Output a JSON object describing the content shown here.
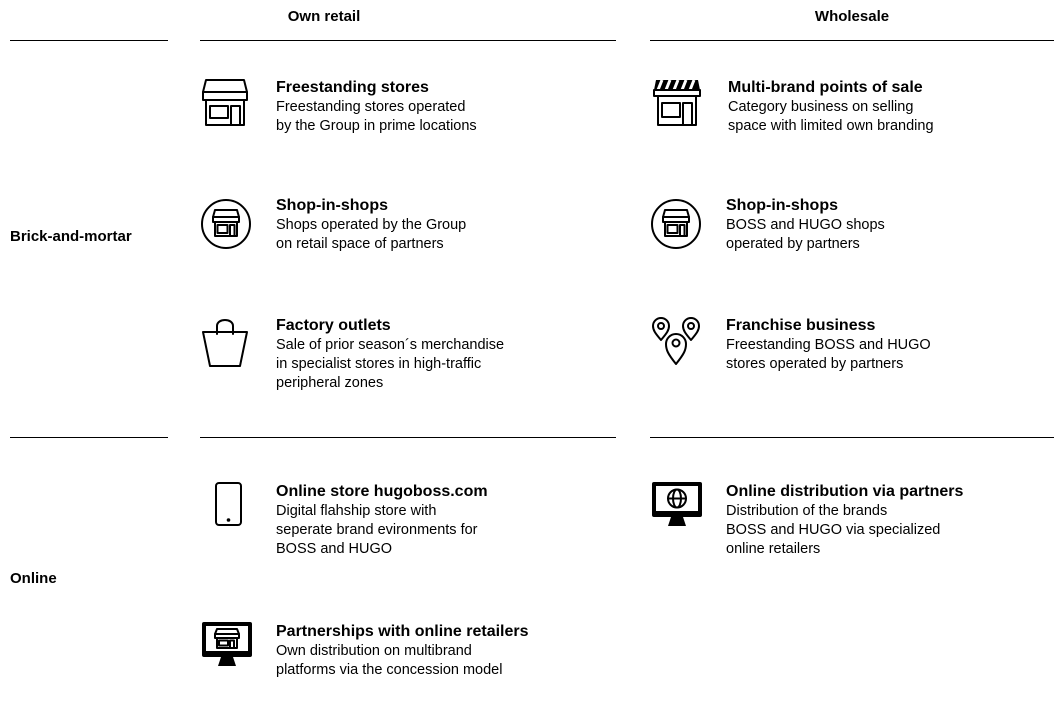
{
  "columns": {
    "own_retail": "Own retail",
    "wholesale": "Wholesale"
  },
  "rows": {
    "brick": "Brick-and-mortar",
    "online": "Online"
  },
  "items": {
    "freestanding": {
      "icon": "storefront-icon",
      "title": "Freestanding stores",
      "desc": "Freestanding stores operated\nby the Group in prime locations"
    },
    "multibrand": {
      "icon": "striped-awning-storefront-icon",
      "title": "Multi-brand points of sale",
      "desc": "Category business on selling\nspace with limited own branding"
    },
    "sis_own": {
      "icon": "circled-storefront-icon",
      "title": "Shop-in-shops",
      "desc": "Shops operated by the Group\non retail space of partners"
    },
    "sis_wholesale": {
      "icon": "circled-storefront-icon",
      "title": "Shop-in-shops",
      "desc": "BOSS and HUGO shops\noperated by partners"
    },
    "factory": {
      "icon": "shopping-bag-icon",
      "title": "Factory outlets",
      "desc": "Sale of prior season´s merchandise\nin specialist stores in high-traffic\nperipheral zones"
    },
    "franchise": {
      "icon": "location-pins-icon",
      "title": "Franchise business",
      "desc": "Freestanding BOSS and HUGO\nstores operated by partners"
    },
    "online_store": {
      "icon": "smartphone-icon",
      "title": "Online store hugoboss.com",
      "desc": "Digital flahship store with\nseperate brand evironments for\nBOSS and HUGO"
    },
    "online_partners": {
      "icon": "monitor-globe-icon",
      "title": "Online distribution via partners",
      "desc": "Distribution of the brands\nBOSS and HUGO via specialized\nonline retailers"
    },
    "partnerships": {
      "icon": "monitor-storefront-icon",
      "title": "Partnerships with online retailers",
      "desc": "Own distribution on multibrand\nplatforms via the concession model"
    }
  }
}
